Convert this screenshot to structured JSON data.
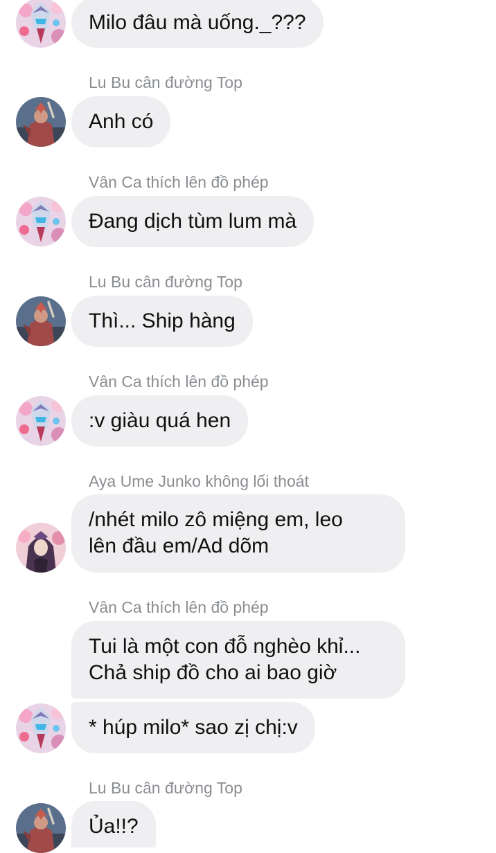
{
  "messages": [
    {
      "text": "Milo đâu mà uống._???"
    },
    {
      "sender": "Lu Bu cân đường Top",
      "text": "Anh có"
    },
    {
      "sender": "Vân Ca thích lên đồ phép",
      "text": "Đang dịch tùm lum mà"
    },
    {
      "sender": "Lu Bu cân đường Top",
      "text": "Thì... Ship hàng"
    },
    {
      "sender": "Vân Ca thích lên đồ phép",
      "text": ":v giàu quá hen"
    },
    {
      "sender": "Aya Ume Junko không lối thoát",
      "line1": "/nhét milo zô miệng em, leo",
      "line2": "lên đầu em/Ad dõm"
    },
    {
      "sender": "Vân Ca thích lên đồ phép",
      "line1": "Tui là một con đỗ nghèo khỉ...",
      "line2": "Chả ship đồ cho ai bao giờ"
    },
    {
      "text": "* húp milo* sao zị chị:v"
    },
    {
      "sender": "Lu Bu cân đường Top",
      "text": "Ủa!!?"
    }
  ]
}
